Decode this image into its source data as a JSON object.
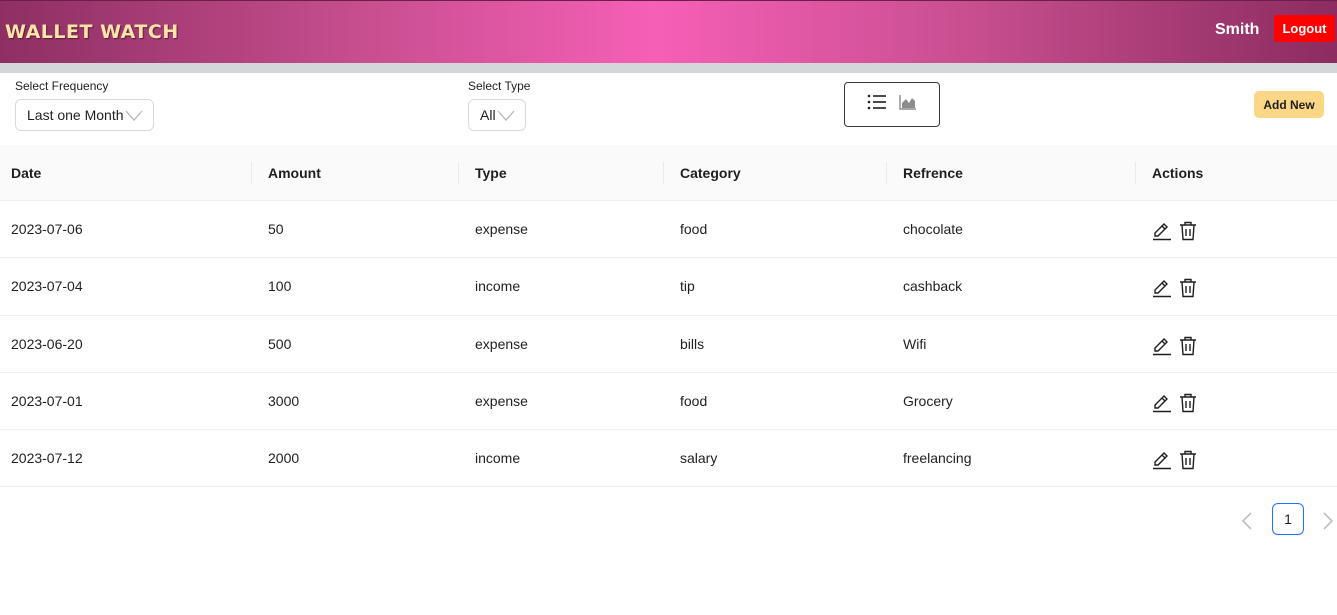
{
  "header": {
    "brand": "WALLET WATCH",
    "username": "Smith",
    "logout_label": "Logout",
    "gradient_colors": [
      "#8e2f63",
      "#f65fb6",
      "#8c2c60"
    ]
  },
  "filters": {
    "frequency_label": "Select Frequency",
    "frequency_value": "Last one Month",
    "type_label": "Select Type",
    "type_value": "All",
    "view_icons": [
      "list-icon",
      "area-chart-icon"
    ],
    "add_new_label": "Add New"
  },
  "table": {
    "columns": [
      "Date",
      "Amount",
      "Type",
      "Category",
      "Refrence",
      "Actions"
    ],
    "rows": [
      {
        "date": "2023-07-06",
        "amount": "50",
        "type": "expense",
        "category": "food",
        "reference": "chocolate"
      },
      {
        "date": "2023-07-04",
        "amount": "100",
        "type": "income",
        "category": "tip",
        "reference": "cashback"
      },
      {
        "date": "2023-06-20",
        "amount": "500",
        "type": "expense",
        "category": "bills",
        "reference": "Wifi"
      },
      {
        "date": "2023-07-01",
        "amount": "3000",
        "type": "expense",
        "category": "food",
        "reference": "Grocery"
      },
      {
        "date": "2023-07-12",
        "amount": "2000",
        "type": "income",
        "category": "salary",
        "reference": "freelancing"
      }
    ],
    "row_action_icons": [
      "edit-icon",
      "delete-icon"
    ]
  },
  "pagination": {
    "current_page": "1"
  },
  "colors": {
    "logout": "#ff0000",
    "add_new": "#fad685",
    "active_page_border": "#1677ff"
  }
}
